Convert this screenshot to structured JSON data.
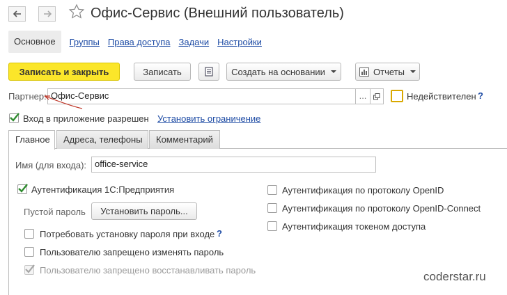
{
  "window": {
    "title": "Офис-Сервис (Внешний пользователь)",
    "back_icon": "arrow-left-icon",
    "forward_icon": "arrow-right-icon",
    "favorite_icon": "star-icon"
  },
  "nav_tabs": [
    {
      "label": "Основное",
      "active": true
    },
    {
      "label": "Группы"
    },
    {
      "label": "Права доступа"
    },
    {
      "label": "Задачи"
    },
    {
      "label": "Настройки"
    }
  ],
  "toolbar": {
    "save_close_label": "Записать и закрыть",
    "save_label": "Записать",
    "report_icon": "document-icon",
    "create_based_label": "Создать на основании",
    "reports_label": "Отчеты"
  },
  "partner": {
    "label": "Партнер:",
    "value": "Офис-Сервис",
    "select_button": "...",
    "open_icon": "open-icon"
  },
  "invalid": {
    "label": "Недействителен",
    "checked": false,
    "help": "?"
  },
  "login_allowed": {
    "label": "Вход в приложение разрешен",
    "checked": true,
    "link": "Установить ограничение"
  },
  "inner_tabs": [
    {
      "label": "Главное",
      "active": true
    },
    {
      "label": "Адреса, телефоны"
    },
    {
      "label": "Комментарий"
    }
  ],
  "login_name": {
    "label": "Имя (для входа):",
    "value": "office-service"
  },
  "auth_1c": {
    "label": "Аутентификация 1С:Предприятия",
    "checked": true
  },
  "password": {
    "status": "Пустой пароль",
    "button_label": "Установить пароль..."
  },
  "options_left": [
    {
      "label": "Потребовать установку пароля при входе",
      "checked": false,
      "help": "?"
    },
    {
      "label": "Пользователю запрещено изменять пароль",
      "checked": false
    },
    {
      "label": "Пользователю запрещено восстанавливать пароль",
      "checked": true,
      "disabled": true
    }
  ],
  "options_right": [
    {
      "label": "Аутентификация по протоколу OpenID",
      "checked": false
    },
    {
      "label": "Аутентификация по протоколу OpenID-Connect",
      "checked": false
    },
    {
      "label": "Аутентификация токеном доступа",
      "checked": false
    }
  ],
  "watermark": "coderstar.ru",
  "colors": {
    "accent_yellow": "#fbe62a",
    "link_blue": "#1c4aa4",
    "check_green": "#2e8b2e",
    "arrow_red": "#c0392b"
  }
}
